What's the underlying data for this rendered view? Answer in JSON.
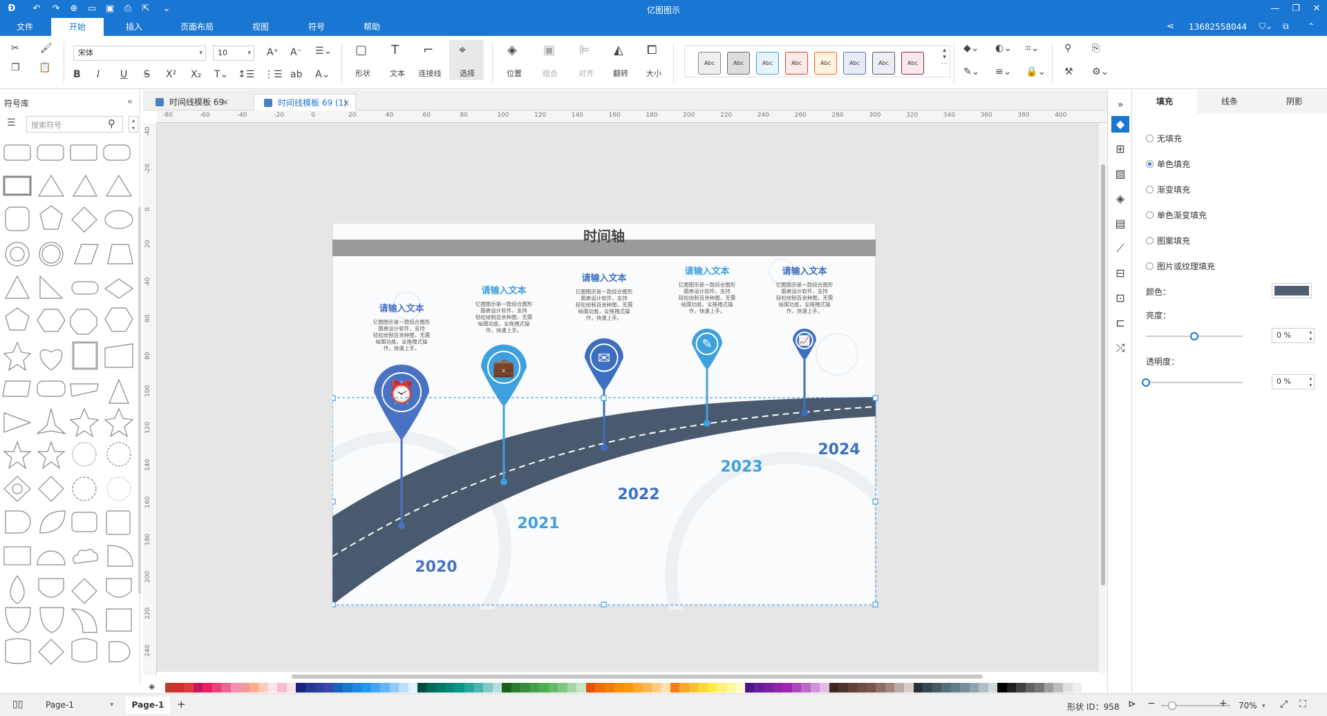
{
  "app": {
    "title": "亿图图示"
  },
  "menu": {
    "items": [
      "文件",
      "开始",
      "插入",
      "页面布局",
      "视图",
      "符号",
      "帮助"
    ],
    "active": "开始"
  },
  "account": {
    "phone": "13682558044"
  },
  "ribbon": {
    "font_name": "宋体",
    "font_size": "10",
    "tools": {
      "shape": "形状",
      "text": "文本",
      "connector": "连接线",
      "select": "选择",
      "position": "位置",
      "group": "组合",
      "align": "对齐",
      "flip": "翻转",
      "size": "大小"
    },
    "style_sample": "Abc"
  },
  "left_panel": {
    "title": "符号库",
    "search_placeholder": "搜索符号"
  },
  "tabs": [
    {
      "label": "时间线模板 69",
      "active": false
    },
    {
      "label": "时间线模板 69 (1)",
      "active": true
    }
  ],
  "ruler": {
    "h_ticks": [
      "-80",
      "-60",
      "-40",
      "-20",
      "0",
      "20",
      "40",
      "60",
      "80",
      "100",
      "120",
      "140",
      "160",
      "180",
      "200",
      "220",
      "240",
      "260",
      "280",
      "300",
      "320",
      "340",
      "360",
      "380",
      "400"
    ],
    "v_ticks": [
      "-40",
      "-20",
      "0",
      "20",
      "40",
      "60",
      "80",
      "100",
      "120",
      "140",
      "160",
      "180",
      "200",
      "220",
      "240"
    ]
  },
  "diagram": {
    "title": "时间轴",
    "milestones": [
      {
        "year": "2020",
        "heading": "请输入文本",
        "body": [
          "亿图图示是一款综合图形",
          "图表设计软件，支持",
          "轻松绘制百余种图，无需",
          "绘图功底，全拖拽式操",
          "作，快速上手。"
        ],
        "icon": "alarm-clock-icon",
        "color": "#4a72c4"
      },
      {
        "year": "2021",
        "heading": "请输入文本",
        "body": [
          "亿图图示是一款综合图形",
          "图表设计软件，支持",
          "轻松绘制百余种图，无需",
          "绘图功底，全拖拽式操",
          "作，快速上手。"
        ],
        "icon": "briefcase-icon",
        "color": "#3ea0dd"
      },
      {
        "year": "2022",
        "heading": "请输入文本",
        "body": [
          "亿图图示是一款综合图形",
          "图表设计软件，支持",
          "轻松绘制百余种图，无需",
          "绘图功底，全拖拽式操",
          "作，快速上手。"
        ],
        "icon": "envelope-icon",
        "color": "#3d6fc0"
      },
      {
        "year": "2023",
        "heading": "请输入文本",
        "body": [
          "亿图图示是一款综合图形",
          "图表设计软件，支持",
          "轻松绘制百余种图，无需",
          "绘图功底，全拖拽式操",
          "作，快速上手。"
        ],
        "icon": "edit-icon",
        "color": "#3ea0dd"
      },
      {
        "year": "2024",
        "heading": "请输入文本",
        "body": [
          "亿图图示是一款综合图形",
          "图表设计软件，支持",
          "轻松绘制百余种图，无需",
          "绘图功底，全拖拽式操",
          "作，快速上手。"
        ],
        "icon": "chart-icon",
        "color": "#3d6fc0"
      }
    ],
    "road_color": "#4a5a6e"
  },
  "right_panel": {
    "tabs": [
      "填充",
      "线条",
      "阴影"
    ],
    "active_tab": "填充",
    "fill_options": [
      "无填充",
      "单色填充",
      "渐变填充",
      "单色渐变填充",
      "图案填充",
      "图片或纹理填充"
    ],
    "selected_fill": "单色填充",
    "color_label": "颜色：",
    "color_value": "#4e6070",
    "brightness_label": "亮度：",
    "brightness_value": "0 %",
    "brightness_level": 0.5,
    "transparency_label": "透明度：",
    "transparency_value": "0 %",
    "transparency_level": 0
  },
  "status": {
    "page_dropdown": "Page-1",
    "page_tab": "Page-1",
    "shape_id": "形状 ID：958",
    "zoom": "70%"
  },
  "palette": [
    "#c0392b",
    "#d32f2f",
    "#e53935",
    "#c2185b",
    "#e91e63",
    "#ec407a",
    "#f06292",
    "#f48fb1",
    "#ef9a9a",
    "#ffab91",
    "#ffccbc",
    "#fce4ec",
    "#f8bbd0",
    "#ffe0e6",
    "#1a237e",
    "#283593",
    "#303f9f",
    "#3949ab",
    "#1565c0",
    "#1976d2",
    "#1e88e5",
    "#2196f3",
    "#42a5f5",
    "#64b5f6",
    "#90caf9",
    "#bbdefb",
    "#e3f2fd",
    "#004d40",
    "#00695c",
    "#00796b",
    "#00897b",
    "#009688",
    "#26a69a",
    "#4db6ac",
    "#80cbc4",
    "#b2dfdb",
    "#1b5e20",
    "#2e7d32",
    "#388e3c",
    "#43a047",
    "#4caf50",
    "#66bb6a",
    "#81c784",
    "#a5d6a7",
    "#c8e6c9",
    "#e65100",
    "#ef6c00",
    "#f57c00",
    "#fb8c00",
    "#ff9800",
    "#ffa726",
    "#ffb74d",
    "#ffcc80",
    "#ffe0b2",
    "#f57f17",
    "#f9a825",
    "#fbc02d",
    "#fdd835",
    "#ffeb3b",
    "#fff176",
    "#fff59d",
    "#fff9c4",
    "#4a148c",
    "#6a1b9a",
    "#7b1fa2",
    "#8e24aa",
    "#9c27b0",
    "#ab47bc",
    "#ba68c8",
    "#ce93d8",
    "#e1bee7",
    "#3e2723",
    "#4e342e",
    "#5d4037",
    "#6d4c41",
    "#795548",
    "#8d6e63",
    "#a1887f",
    "#bcaaa4",
    "#d7ccc8",
    "#263238",
    "#37474f",
    "#455a64",
    "#546e7a",
    "#607d8b",
    "#78909c",
    "#90a4ae",
    "#b0bec5",
    "#cfd8dc",
    "#000000",
    "#212121",
    "#424242",
    "#616161",
    "#757575",
    "#9e9e9e",
    "#bdbdbd",
    "#e0e0e0",
    "#eeeeee",
    "#ffffff"
  ]
}
